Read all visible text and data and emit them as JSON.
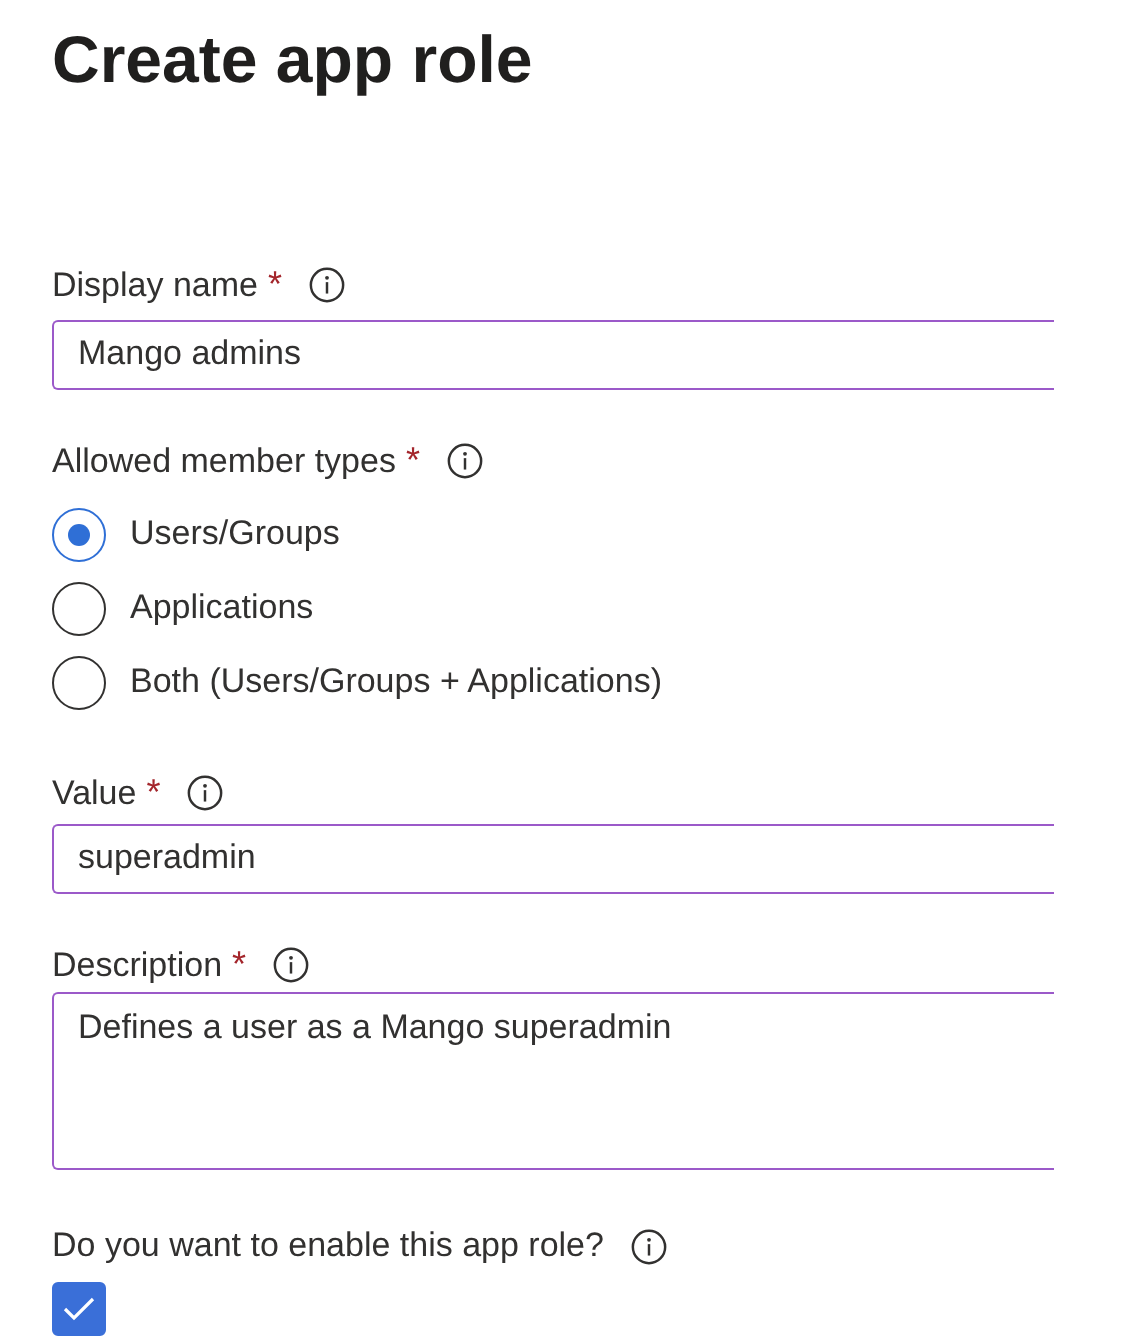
{
  "title": "Create app role",
  "display_name": {
    "label": "Display name",
    "required_mark": "*",
    "value": "Mango admins"
  },
  "member_types": {
    "label": "Allowed member types",
    "required_mark": "*",
    "options": [
      {
        "label": "Users/Groups",
        "selected": true
      },
      {
        "label": "Applications",
        "selected": false
      },
      {
        "label": "Both (Users/Groups + Applications)",
        "selected": false
      }
    ]
  },
  "value_field": {
    "label": "Value",
    "required_mark": "*",
    "value": "superadmin"
  },
  "description": {
    "label": "Description",
    "required_mark": "*",
    "value": "Defines a user as a Mango superadmin"
  },
  "enable": {
    "label": "Do you want to enable this app role?",
    "checked": true
  }
}
